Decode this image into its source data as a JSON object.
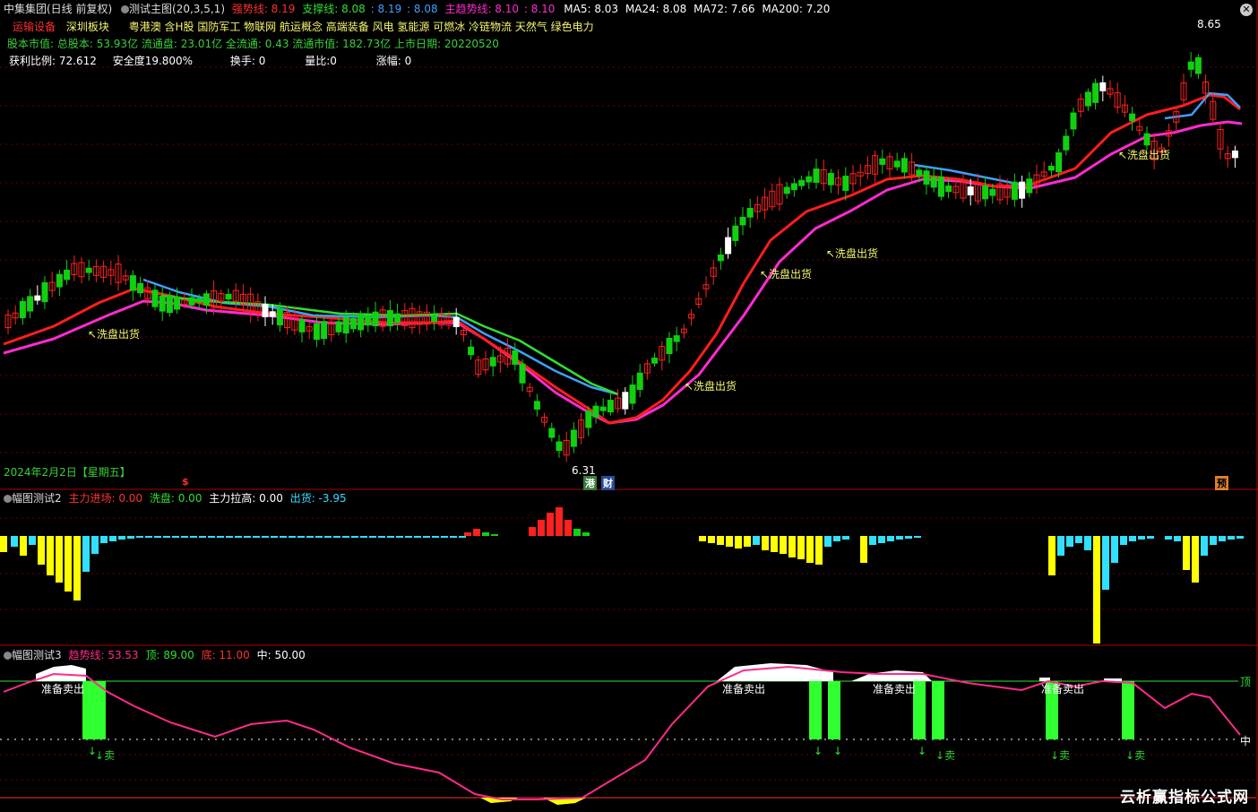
{
  "header": {
    "stock": "中集集团(日线 前复权)",
    "indicator": "测试主图(20,3,5,1)",
    "strong_label": "强势线: 8.19",
    "support_label": "支撑线: 8.08",
    "sep1": ": 8.19",
    "sep2": ": 8.08",
    "main_trend_label": "主趋势线: 8.10",
    "sep3": ": 8.10",
    "ma5": "MA5: 8.03",
    "ma24": "MA24: 8.08",
    "ma72": "MA72: 7.66",
    "ma200": "MA200: 7.20"
  },
  "sectors": {
    "industry": "运输设备",
    "board": "深圳板块",
    "concepts": "粤港澳 含H股 国防军工 物联网 航运概念 高端装备 风电 氢能源 可燃冰 冷链物流 天然气 绿色电力"
  },
  "stats": {
    "line1": "股本市值: 总股本: 53.93亿 流通盘: 23.01亿 全流通: 0.43 流通市值: 182.73亿 上市日期: 20220520",
    "profit": "获利比例: 72.612",
    "safety": "安全度19.800%",
    "turnover": "换手: 0",
    "vol_ratio": "量比:0",
    "change": "涨幅: 0"
  },
  "annotations": {
    "wash": "↖洗盘出货",
    "high": "8.65",
    "low": "6.31",
    "date": "2024年2月2日【星期五】",
    "badge_s": "$",
    "badge_hk": "港",
    "badge_cai": "财",
    "badge_yu": "预"
  },
  "panel2": {
    "title": "幅图测试2",
    "main_in": "主力进场: 0.00",
    "wash": "洗盘: 0.00",
    "pull": "主力拉高: 0.00",
    "out": "出货: -3.95"
  },
  "panel3": {
    "title": "幅图测试3",
    "trend": "趋势线: 53.53",
    "top": "顶: 89.00",
    "bottom": "底: 11.00",
    "mid": "中: 50.00",
    "ready_sell": "准备卖出",
    "sell": "卖",
    "top_tag": "顶",
    "mid_tag": "中"
  },
  "watermark": "云析赢指标公式网",
  "colors": {
    "up": "#ff2020",
    "down": "#10d010",
    "red_line": "#ff1e1e",
    "magenta_line": "#ff2bd0",
    "blue_line": "#3fa0ff",
    "green_line": "#30e030",
    "yellow": "#ffff00",
    "cyan": "#30e0ff",
    "grid": "#7a0000"
  }
}
